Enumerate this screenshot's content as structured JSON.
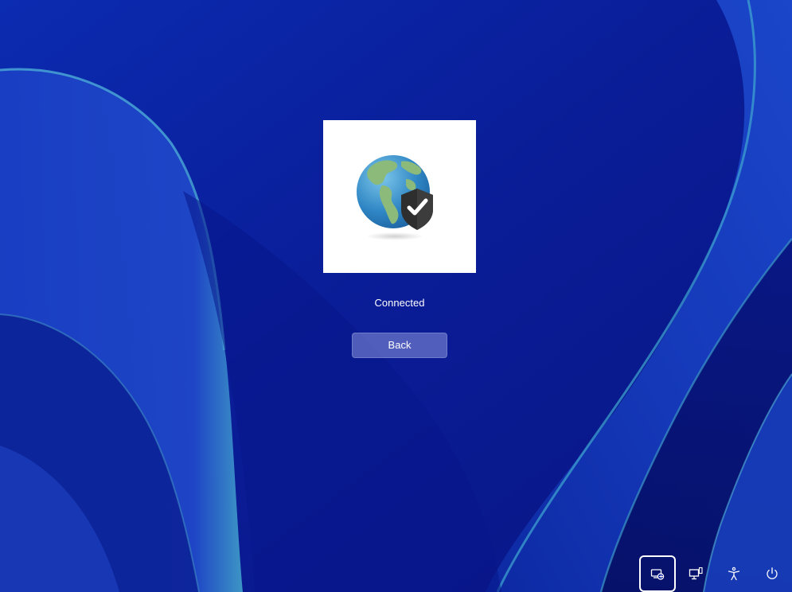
{
  "status": {
    "text": "Connected"
  },
  "back_button": {
    "label": "Back"
  },
  "tile": {
    "icon": "globe-shield-check-icon"
  },
  "tray": {
    "items": [
      {
        "name": "network-icon",
        "selected": true
      },
      {
        "name": "remote-desktop-icon",
        "selected": false
      },
      {
        "name": "accessibility-icon",
        "selected": false
      },
      {
        "name": "power-icon",
        "selected": false
      }
    ]
  },
  "colors": {
    "wallpaper_base": "#0a1f9e",
    "wallpaper_highlight": "#3fa0c8",
    "button_fill": "#6f78c8",
    "text": "#ffffff"
  }
}
